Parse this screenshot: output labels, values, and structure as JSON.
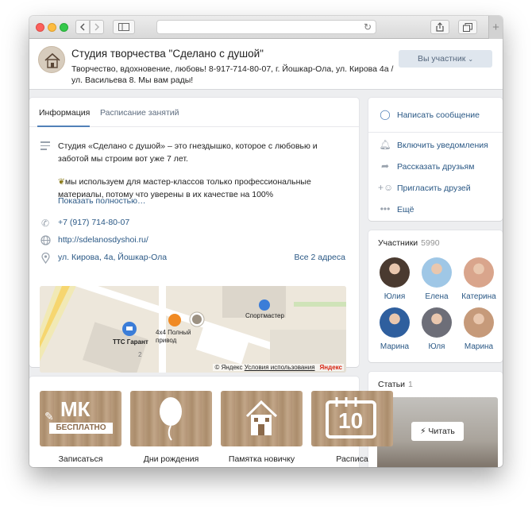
{
  "browser": {
    "back_icon": "chevron-left-icon",
    "forward_icon": "chevron-right-icon",
    "sidebar_icon": "sidebar-icon",
    "reload_icon": "reload-icon",
    "share_icon": "share-icon",
    "tabs_icon": "tabs-icon",
    "new_tab_label": "+"
  },
  "group": {
    "title": "Студия творчества \"Сделано с душой\"",
    "status": "Творчество, вдохновение, любовь! 8-917-714-80-07, г. Йошкар-Ола, ул. Кирова 4а / ул. Васильева 8. Мы вам рады!",
    "member_button": "Вы участник",
    "member_button_chevron": "⌄"
  },
  "info": {
    "tabs": [
      {
        "label": "Информация",
        "active": true
      },
      {
        "label": "Расписание занятий",
        "active": false
      }
    ],
    "description_p1": "Студия «Сделано с душой» – это гнездышко, которое с любовью и заботой мы строим вот уже 7 лет.",
    "description_p2": "мы используем для мастер-классов только профессиональные материалы, потому что уверены в их качестве на 100%",
    "show_more": "Показать полностью…",
    "phone": "+7 (917) 714-80-07",
    "website": "http://sdelanosdyshoi.ru/",
    "address": "ул. Кирова, 4а, Йошкар-Ола",
    "all_addresses": "Все 2 адреса",
    "map": {
      "label_ttc": "ТТС Гарант",
      "label_4x4": "4x4 Полный привод",
      "label_sportmaster": "Спортмастер",
      "label_number": "2",
      "copyright": "© Яндекс",
      "terms": "Условия использования",
      "brand": "Яндекс"
    }
  },
  "actions": {
    "items": [
      {
        "label": "Написать сообщение",
        "icon": "message-icon"
      },
      {
        "label": "Включить уведомления",
        "icon": "bell-icon"
      },
      {
        "label": "Рассказать друзьям",
        "icon": "share-arrow-icon"
      },
      {
        "label": "Пригласить друзей",
        "icon": "add-friend-icon"
      },
      {
        "label": "Ещё",
        "icon": "more-icon"
      }
    ]
  },
  "members": {
    "title": "Участники",
    "count": "5990",
    "people": [
      {
        "name": "Юлия",
        "color": "#4a3a30"
      },
      {
        "name": "Елена",
        "color": "#9fc7e6"
      },
      {
        "name": "Катерина",
        "color": "#d9a58c"
      },
      {
        "name": "Марина",
        "color": "#2f5f9e"
      },
      {
        "name": "Юля",
        "color": "#6d6e78"
      },
      {
        "name": "Марина",
        "color": "#c69a7a"
      }
    ]
  },
  "articles": {
    "title": "Статьи",
    "count": "1",
    "read_button": "Читать",
    "read_icon": "bolt-icon"
  },
  "menu_tiles": [
    {
      "caption": "Записаться",
      "overlay": "МК",
      "overlay_sub": "БЕСПЛАТНО",
      "icon": "pencil-icon"
    },
    {
      "caption": "Дни рождения",
      "overlay": "",
      "overlay_sub": "",
      "icon": "balloon-icon"
    },
    {
      "caption": "Памятка новичку",
      "overlay": "",
      "overlay_sub": "",
      "icon": "house-icon"
    },
    {
      "caption": "Расписа",
      "overlay": "10",
      "overlay_sub": "",
      "icon": "calendar-icon"
    }
  ]
}
